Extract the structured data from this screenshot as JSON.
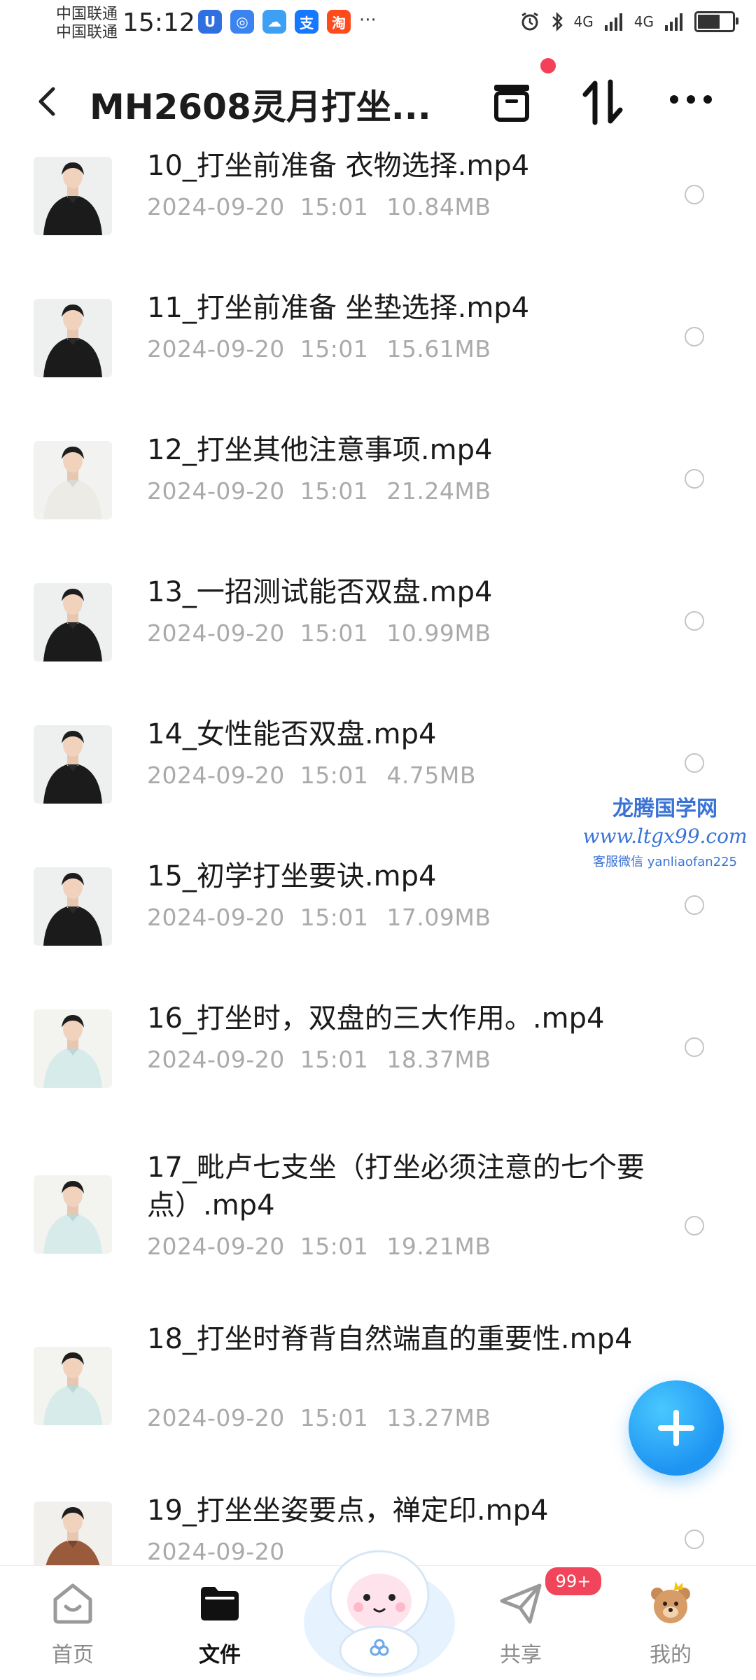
{
  "status_bar": {
    "carrier_1": "中国联通",
    "carrier_2": "中国联通",
    "time": "15:12",
    "more": "···",
    "app_icons": [
      {
        "name": "app-shield",
        "color": "#2f6fe0",
        "glyph": "U"
      },
      {
        "name": "app-browser",
        "color": "#3b84f0",
        "glyph": "◎"
      },
      {
        "name": "app-weather",
        "color": "#3da0f5",
        "glyph": "☁"
      },
      {
        "name": "app-alipay",
        "color": "#1677ff",
        "glyph": "支"
      },
      {
        "name": "app-taobao",
        "color": "#ff4a1c",
        "glyph": "淘"
      }
    ],
    "signal_1": "4G",
    "signal_2": "4G"
  },
  "header": {
    "title": "MH2608灵月打坐..."
  },
  "files": [
    {
      "name": "10_打坐前准备 衣物选择.mp4",
      "date": "2024-09-20",
      "time": "15:01",
      "size": "10.84MB",
      "thumb": "black"
    },
    {
      "name": "11_打坐前准备 坐垫选择.mp4",
      "date": "2024-09-20",
      "time": "15:01",
      "size": "15.61MB",
      "thumb": "black"
    },
    {
      "name": "12_打坐其他注意事项.mp4",
      "date": "2024-09-20",
      "time": "15:01",
      "size": "21.24MB",
      "thumb": "white"
    },
    {
      "name": "13_一招测试能否双盘.mp4",
      "date": "2024-09-20",
      "time": "15:01",
      "size": "10.99MB",
      "thumb": "black"
    },
    {
      "name": "14_女性能否双盘.mp4",
      "date": "2024-09-20",
      "time": "15:01",
      "size": "4.75MB",
      "thumb": "black"
    },
    {
      "name": "15_初学打坐要诀.mp4",
      "date": "2024-09-20",
      "time": "15:01",
      "size": "17.09MB",
      "thumb": "black"
    },
    {
      "name": "16_打坐时，双盘的三大作用。.mp4",
      "date": "2024-09-20",
      "time": "15:01",
      "size": "18.37MB",
      "thumb": "mint"
    },
    {
      "name": "17_毗卢七支坐（打坐必须注意的七个要点）.mp4",
      "date": "2024-09-20",
      "time": "15:01",
      "size": "19.21MB",
      "thumb": "mint"
    },
    {
      "name": "18_打坐时脊背自然端直的重要性.mp4",
      "date": "2024-09-20",
      "time": "15:01",
      "size": "13.27MB",
      "thumb": "mint"
    },
    {
      "name": "19_打坐坐姿要点，禅定印.mp4",
      "date": "2024-09-20",
      "time": "",
      "size": "",
      "thumb": "brown"
    }
  ],
  "watermark": {
    "line1": "龙腾国学网",
    "line2": "www.ltgx99.com",
    "line3": "客服微信 yanliaofan225"
  },
  "bottom_nav": {
    "items": [
      {
        "label": "首页",
        "icon": "home-icon",
        "active": false
      },
      {
        "label": "文件",
        "icon": "folder-icon",
        "active": true
      },
      {
        "label": "共享",
        "icon": "share-icon",
        "active": false
      },
      {
        "label": "我的",
        "icon": "profile-icon",
        "active": false
      }
    ],
    "share_badge": "99+"
  },
  "colors": {
    "accent": "#1d93f2",
    "badge": "#f0455a",
    "meta_text": "#aaaaaa"
  }
}
